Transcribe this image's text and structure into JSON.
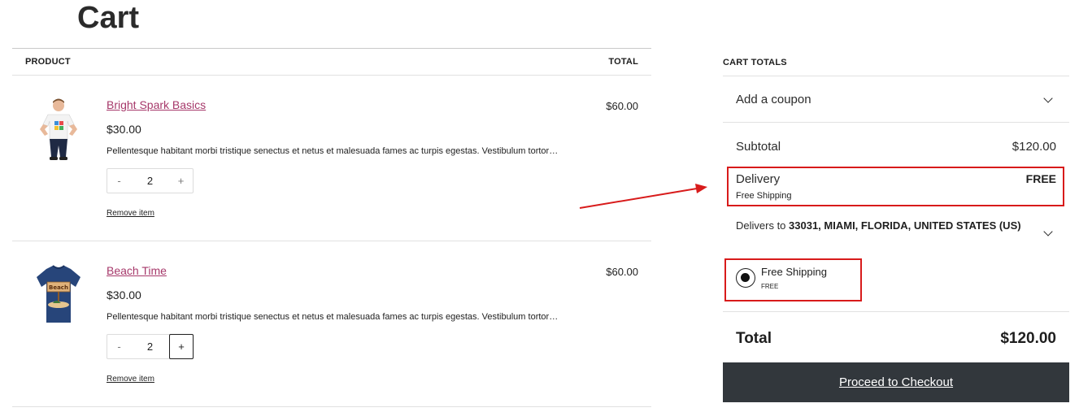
{
  "page": {
    "title": "Cart"
  },
  "table": {
    "col_product": "PRODUCT",
    "col_total": "TOTAL"
  },
  "items": [
    {
      "name": "Bright Spark Basics",
      "price": "$30.00",
      "description": "Pellentesque habitant morbi tristique senectus et netus et malesuada fames ac turpis egestas. Vestibulum tortor…",
      "quantity": "2",
      "minus": "-",
      "plus": "+",
      "total": "$60.00",
      "remove": "Remove item"
    },
    {
      "name": "Beach Time",
      "price": "$30.00",
      "description": "Pellentesque habitant morbi tristique senectus et netus et malesuada fames ac turpis egestas. Vestibulum tortor…",
      "quantity": "2",
      "minus": "-",
      "plus": "+",
      "total": "$60.00",
      "remove": "Remove item",
      "shirt_text": "Beach"
    }
  ],
  "totals": {
    "title": "CART TOTALS",
    "coupon_label": "Add a coupon",
    "subtotal_label": "Subtotal",
    "subtotal_value": "$120.00",
    "delivery_label": "Delivery",
    "delivery_value": "FREE",
    "delivery_method": "Free Shipping",
    "delivers_to_prefix": "Delivers to ",
    "delivers_to_address": "33031, MIAMI, FLORIDA, UNITED STATES (US)",
    "shipping_option_label": "Free Shipping",
    "shipping_option_price": "FREE",
    "total_label": "Total",
    "total_value": "$120.00",
    "checkout_label": "Proceed to Checkout"
  },
  "colors": {
    "link": "#a6386a",
    "button_bg": "#32373c",
    "annotation": "#d81b1b"
  }
}
